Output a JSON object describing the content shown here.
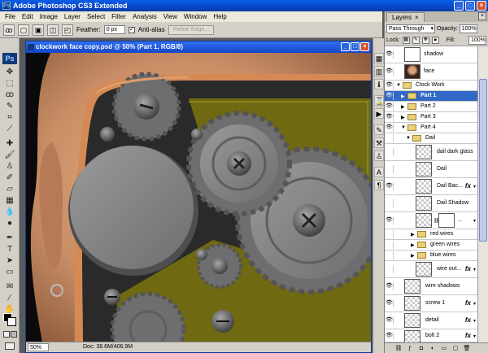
{
  "app": {
    "title": "Adobe Photoshop CS3 Extended",
    "logo": "Ps",
    "window_buttons": [
      "_",
      "□",
      "×"
    ]
  },
  "menu": [
    "File",
    "Edit",
    "Image",
    "Layer",
    "Select",
    "Filter",
    "Analysis",
    "View",
    "Window",
    "Help"
  ],
  "options_bar": {
    "feather_label": "Feather:",
    "feather_value": "0 px",
    "antialias_label": "Anti-alias",
    "antialias_checked": "✓",
    "refine_edge_label": "Refine Edge..."
  },
  "document": {
    "title": "clockwork face copy.psd @ 50% (Part 1, RGB/8)",
    "zoom": "50%",
    "doc_size": "Doc: 38.6M/406.9M"
  },
  "tools": {
    "badge": "Ps"
  },
  "layers_panel": {
    "tab_label": "Layers",
    "tab_close": "×",
    "blend_mode": "Pass Through",
    "opacity_label": "Opacity:",
    "opacity_value": "100%",
    "lock_label": "Lock:",
    "fill_label": "Fill:",
    "fill_value": "100%",
    "layers": [
      {
        "name": "shadow",
        "kind": "layer",
        "thumb": "shadow",
        "visible": true
      },
      {
        "name": "face",
        "kind": "layer",
        "thumb": "face",
        "visible": true
      },
      {
        "name": "Clock Work",
        "kind": "group",
        "expanded": true,
        "visible": true
      },
      {
        "name": "Part 1",
        "kind": "group",
        "selected": true,
        "visible": true
      },
      {
        "name": "Part 2",
        "kind": "group",
        "visible": true
      },
      {
        "name": "Part 3",
        "kind": "group",
        "visible": true
      },
      {
        "name": "Part 4",
        "kind": "group",
        "expanded": true,
        "visible": true
      },
      {
        "name": "Dail",
        "kind": "group",
        "expanded": true,
        "visible": false
      },
      {
        "name": "dail dark glass",
        "kind": "layer",
        "thumb": "checker",
        "visible": false
      },
      {
        "name": "Dail",
        "kind": "layer",
        "thumb": "checker",
        "visible": false
      },
      {
        "name": "Dail Bac...",
        "kind": "layer",
        "thumb": "checker",
        "fx": "fx",
        "visible": true
      },
      {
        "name": "Dail Shadow",
        "kind": "layer",
        "thumb": "checker",
        "visible": false
      },
      {
        "name": "...",
        "kind": "masked",
        "thumb": "checker",
        "visible": true
      },
      {
        "name": "red wires",
        "kind": "group",
        "visible": false
      },
      {
        "name": "green wires",
        "kind": "group",
        "visible": false
      },
      {
        "name": "blue wires",
        "kind": "group",
        "visible": false
      },
      {
        "name": "wire out...",
        "kind": "layer",
        "thumb": "checker",
        "fx": "fx",
        "visible": false
      },
      {
        "name": "wire shadows",
        "kind": "layer",
        "thumb": "checker",
        "visible": true
      },
      {
        "name": "screw 1",
        "kind": "layer",
        "thumb": "checker",
        "fx": "fx",
        "visible": true
      },
      {
        "name": "detail",
        "kind": "layer",
        "thumb": "checker",
        "fx": "fx",
        "visible": true
      },
      {
        "name": "bolt 2",
        "kind": "layer",
        "thumb": "checker",
        "fx": "fx",
        "visible": true
      }
    ]
  },
  "colors": {
    "accent": "#3169c6",
    "titlebar": "#0a48c8",
    "metal_plate": "#7f7f80",
    "olive_plate": "#6f6a12",
    "skin": "#d9a27a"
  }
}
